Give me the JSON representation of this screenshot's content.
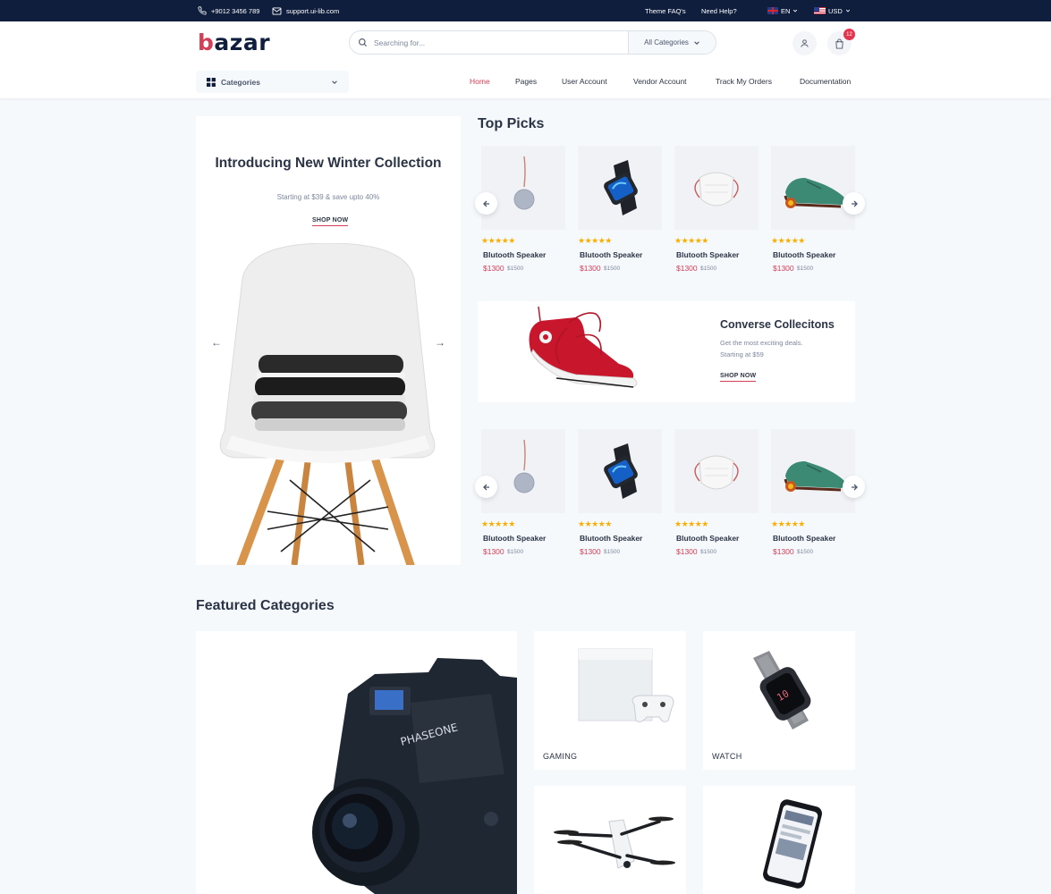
{
  "topbar": {
    "phone": "+9012 3456 789",
    "email": "support.ui-lib.com",
    "faq": "Theme FAQ's",
    "help": "Need Help?",
    "language": "EN",
    "currency": "USD"
  },
  "header": {
    "logo_prefix": "b",
    "logo_rest": "azar",
    "search_placeholder": "Searching for...",
    "category_select": "All Categories",
    "cart_count": "12",
    "categories_button": "Categories"
  },
  "nav": {
    "items": [
      "Home",
      "Pages",
      "User Account",
      "Vendor Account",
      "Track My Orders",
      "Documentation"
    ],
    "active": "Home"
  },
  "hero": {
    "title": "Introducing New Winter Collection",
    "subtitle": "Starting at $39 & save upto 40%",
    "cta": "SHOP NOW"
  },
  "top_picks": {
    "title": "Top Picks",
    "row1": [
      {
        "name": "Blutooth Speaker",
        "price": "$1300",
        "old_price": "$1500",
        "rating": 5,
        "image": "speaker"
      },
      {
        "name": "Blutooth Speaker",
        "price": "$1300",
        "old_price": "$1500",
        "rating": 5,
        "image": "watch"
      },
      {
        "name": "Blutooth Speaker",
        "price": "$1300",
        "old_price": "$1500",
        "rating": 5,
        "image": "mask"
      },
      {
        "name": "Blutooth Speaker",
        "price": "$1300",
        "old_price": "$1500",
        "rating": 5,
        "image": "shoe"
      }
    ],
    "row2": [
      {
        "name": "Blutooth Speaker",
        "price": "$1300",
        "old_price": "$1500",
        "rating": 5,
        "image": "speaker"
      },
      {
        "name": "Blutooth Speaker",
        "price": "$1300",
        "old_price": "$1500",
        "rating": 5,
        "image": "watch"
      },
      {
        "name": "Blutooth Speaker",
        "price": "$1300",
        "old_price": "$1500",
        "rating": 5,
        "image": "mask"
      },
      {
        "name": "Blutooth Speaker",
        "price": "$1300",
        "old_price": "$1500",
        "rating": 5,
        "image": "shoe"
      }
    ]
  },
  "banner": {
    "title": "Converse Collecitons",
    "line1": "Get the most exciting deals.",
    "line2": "Starting at $59",
    "cta": "SHOP NOW"
  },
  "featured": {
    "title": "Featured Categories",
    "cards": [
      {
        "label": "",
        "image": "camera"
      },
      {
        "label": "GAMING",
        "image": "console"
      },
      {
        "label": "WATCH",
        "image": "smartwatch"
      },
      {
        "label": "",
        "image": "drone"
      },
      {
        "label": "",
        "image": "phone"
      }
    ]
  },
  "colors": {
    "primary": "#d23f57",
    "dark": "#0f1e3d",
    "text": "#2b3445",
    "muted": "#7d879c",
    "star": "#faaf00",
    "background": "#f6f9fc"
  }
}
